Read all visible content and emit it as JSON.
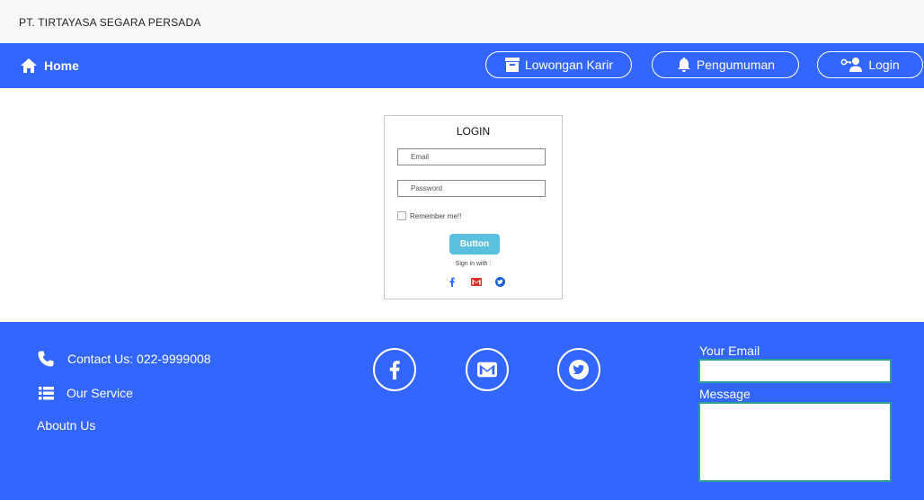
{
  "header": {
    "company_name": "PT. TIRTAYASA SEGARA PERSADA"
  },
  "navbar": {
    "home_label": "Home",
    "karir_label": "Lowongan Karir",
    "pengumuman_label": "Pengumuman",
    "login_label": "Login",
    "icons": {
      "home": "home-icon",
      "karir": "archive-box-icon",
      "pengumuman": "bell-icon",
      "login": "user-key-icon"
    }
  },
  "login_form": {
    "title": "LOGIN",
    "email_placeholder": "Email",
    "password_placeholder": "Password",
    "remember_label": "Remember me!!",
    "remember_checked": false,
    "submit_label": "Button",
    "signin_with_label": "Sign in with :",
    "social": [
      "facebook-icon",
      "gmail-icon",
      "twitter-icon"
    ]
  },
  "footer": {
    "contact_label": "Contact Us: 022-9999008",
    "service_label": "Our Service",
    "about_label": "Aboutn Us",
    "social": [
      "facebook-icon",
      "gmail-icon",
      "twitter-icon"
    ],
    "email_label": "Your Email",
    "message_label": "Message",
    "email_value": "",
    "message_value": ""
  },
  "colors": {
    "nav_bg": "#3366ff",
    "footer_bg": "#3366ff",
    "topbar_bg": "#f7f7f7",
    "login_button": "#5bc0de",
    "facebook": "#3b5998",
    "gmail": "#d93025",
    "twitter": "#1da1f2",
    "input_border": "#2aa198"
  }
}
